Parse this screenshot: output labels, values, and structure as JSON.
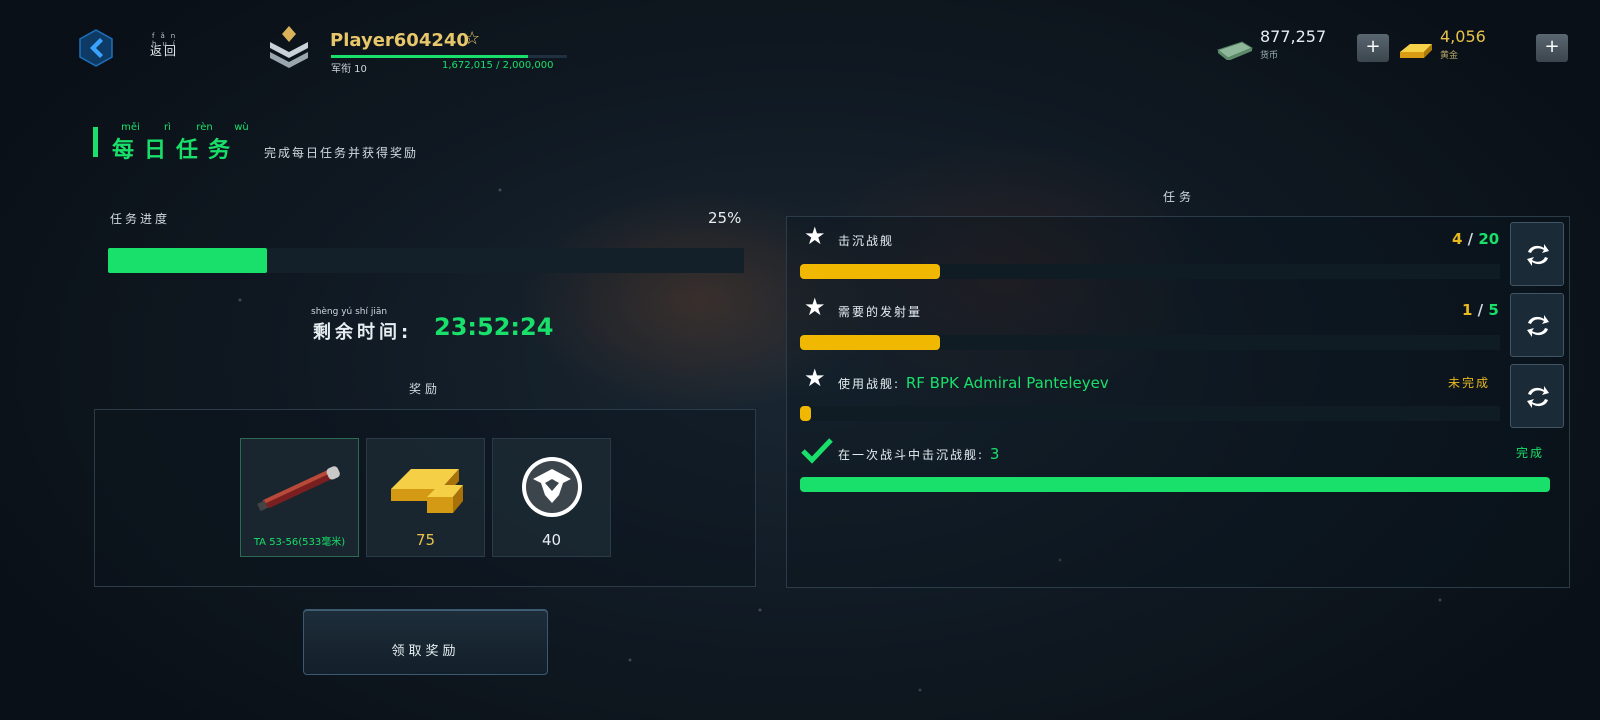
{
  "header": {
    "back_label": "返回",
    "back_ruby": "fǎn huí",
    "player_name": "Player604240",
    "rank_label": "军衔 10",
    "xp_current": "1,672,015",
    "xp_max": "2,000,000",
    "xp_text": "1,672,015 / 2,000,000",
    "xp_fraction": 0.836,
    "money_value": "877,257",
    "money_label": "货币",
    "gold_value": "4,056",
    "gold_label": "黄金"
  },
  "section": {
    "title": "每日任务",
    "title_ruby": [
      "měi",
      "rì",
      "rèn",
      "wù"
    ],
    "subtitle": "完成每日任务并获得奖励"
  },
  "progress": {
    "label": "任务进度",
    "percent_text": "25%",
    "fraction": 0.25
  },
  "timer": {
    "label": "剩余时间",
    "ruby": "shèng  yú  shí  jiān",
    "value": "23:52:24"
  },
  "rewards": {
    "label": "奖励",
    "items": [
      {
        "name": "TA 53-56(533毫米)",
        "qty": ""
      },
      {
        "name": "",
        "qty": "75"
      },
      {
        "name": "",
        "qty": "40"
      }
    ],
    "claim_label": "领取奖励"
  },
  "tasks": {
    "label": "任务",
    "list": [
      {
        "text": "击沉战舰",
        "highlight": "",
        "current": "4",
        "total": "20",
        "fraction": 0.2,
        "status": ""
      },
      {
        "text": "需要的发射量",
        "highlight": "",
        "current": "1",
        "total": "5",
        "fraction": 0.2,
        "status": ""
      },
      {
        "text": "使用战舰: ",
        "highlight": "RF BPK Admiral Panteleyev",
        "current": "",
        "total": "",
        "fraction": 0.015,
        "status": "未完成"
      },
      {
        "text": "在一次战斗中击沉战舰: ",
        "highlight": "3",
        "current": "",
        "total": "",
        "fraction": 1.0,
        "status": "完成"
      }
    ]
  },
  "colors": {
    "accent_green": "#19e06a",
    "accent_yellow": "#f0b800",
    "gold_text": "#e8c24a"
  }
}
